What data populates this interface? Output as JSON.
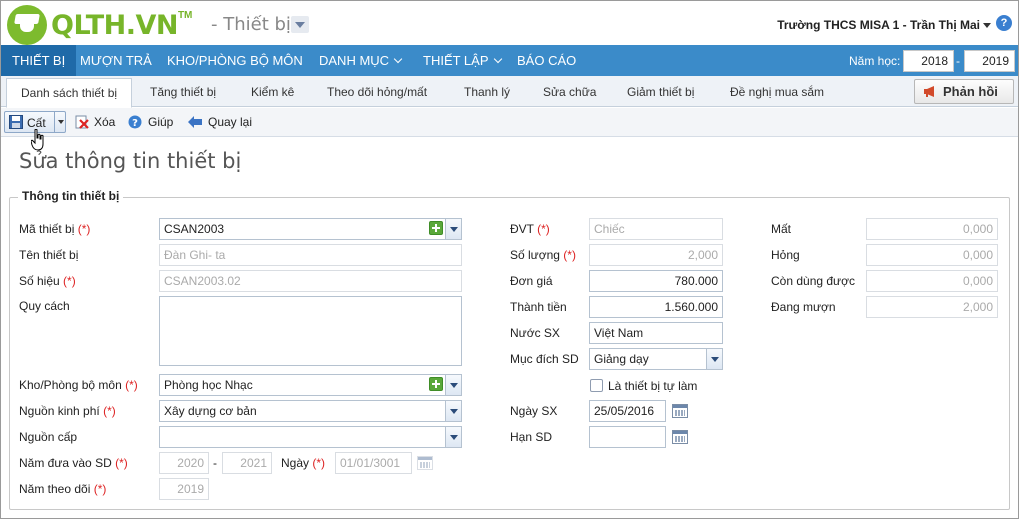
{
  "brand": {
    "logo_text": "QLTH.VN",
    "trademark": "TM",
    "module": "- Thiết bị"
  },
  "user": {
    "text": "Trường THCS MISA 1 - Trần Thị Mai"
  },
  "nav": {
    "items": [
      "THIẾT BỊ",
      "MƯỢN TRẢ",
      "KHO/PHÒNG BỘ MÔN",
      "DANH MỤC",
      "THIẾT LẬP",
      "BÁO CÁO"
    ],
    "year_label": "Năm học:",
    "year_from": "2018",
    "year_sep": "-",
    "year_to": "2019"
  },
  "subtabs": {
    "items": [
      "Danh sách thiết bị",
      "Tăng thiết bị",
      "Kiểm kê",
      "Theo dõi hỏng/mất",
      "Thanh lý",
      "Sửa chữa",
      "Giảm thiết bị",
      "Đề nghị mua sắm"
    ],
    "feedback": "Phản hồi"
  },
  "toolbar": {
    "save": "Cất",
    "delete": "Xóa",
    "help": "Giúp",
    "back": "Quay lại"
  },
  "page": {
    "title": "Sửa thông tin thiết bị",
    "section": "Thông tin thiết bị"
  },
  "form": {
    "ma_thiet_bi": {
      "label": "Mã thiết bị",
      "req": "(*)",
      "value": "CSAN2003"
    },
    "ten_thiet_bi": {
      "label": "Tên thiết bị",
      "value": "Đàn Ghi- ta"
    },
    "so_hieu": {
      "label": "Số hiệu",
      "req": "(*)",
      "value": "CSAN2003.02"
    },
    "quy_cach": {
      "label": "Quy cách",
      "value": ""
    },
    "kho": {
      "label": "Kho/Phòng bộ môn",
      "req": "(*)",
      "value": "Phòng học Nhạc"
    },
    "nguon_kinh_phi": {
      "label": "Nguồn kinh phí",
      "req": "(*)",
      "value": "Xây dựng cơ bản"
    },
    "nguon_cap": {
      "label": "Nguồn cấp",
      "value": ""
    },
    "nam_dua_vao": {
      "label": "Năm đưa vào SD",
      "req": "(*)",
      "from": "2020",
      "sep": "-",
      "to": "2021"
    },
    "ngay": {
      "label": "Ngày",
      "req": "(*)",
      "value": "01/01/3001"
    },
    "nam_theo_doi": {
      "label": "Năm theo dõi",
      "req": "(*)",
      "value": "2019"
    },
    "dvt": {
      "label": "ĐVT",
      "req": "(*)",
      "value": "Chiếc"
    },
    "so_luong": {
      "label": "Số lượng",
      "req": "(*)",
      "value": "2,000"
    },
    "don_gia": {
      "label": "Đơn giá",
      "value": "780.000"
    },
    "thanh_tien": {
      "label": "Thành tiền",
      "value": "1.560.000"
    },
    "nuoc_sx": {
      "label": "Nước SX",
      "value": "Việt Nam"
    },
    "muc_dich": {
      "label": "Mục đích SD",
      "value": "Giảng dạy"
    },
    "tu_lam": {
      "label": "Là thiết bị tự làm",
      "checked": false
    },
    "ngay_sx": {
      "label": "Ngày SX",
      "value": "25/05/2016"
    },
    "han_sd": {
      "label": "Hạn SD",
      "value": ""
    },
    "mat": {
      "label": "Mất",
      "value": "0,000"
    },
    "hong": {
      "label": "Hỏng",
      "value": "0,000"
    },
    "con_dung": {
      "label": "Còn dùng được",
      "value": "0,000"
    },
    "dang_muon": {
      "label": "Đang mượn",
      "value": "2,000"
    }
  },
  "colors": {
    "brand_green": "#77b52a",
    "nav_blue": "#3b8bc9",
    "nav_active": "#1f6aa8",
    "required": "#dd2222"
  }
}
